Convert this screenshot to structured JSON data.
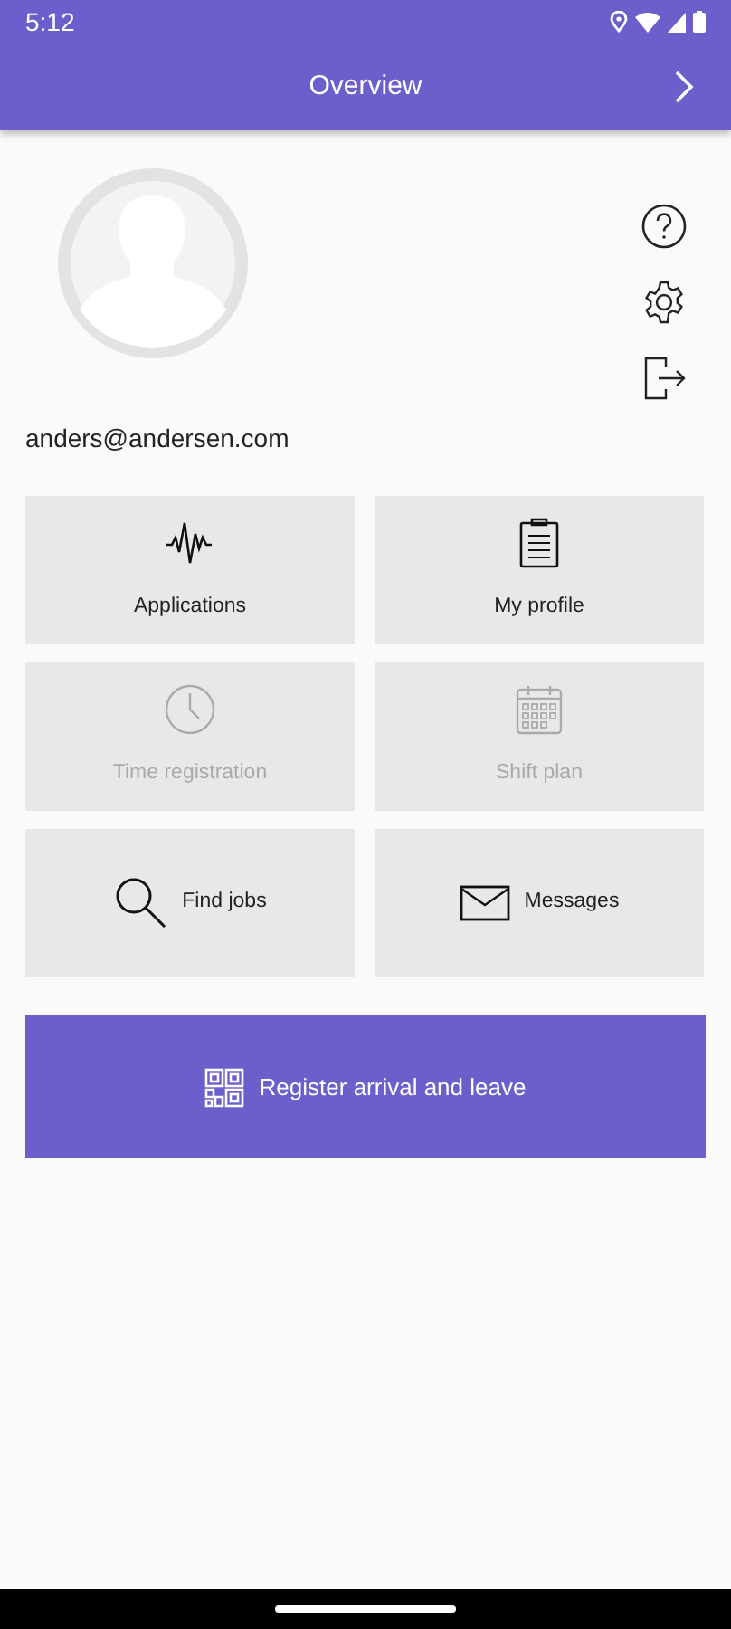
{
  "status_bar": {
    "time": "5:12"
  },
  "app_bar": {
    "title": "Overview"
  },
  "profile": {
    "email": "anders@andersen.com"
  },
  "tiles": [
    {
      "label": "Applications",
      "kind": "stacked",
      "disabled": false
    },
    {
      "label": "My profile",
      "kind": "stacked",
      "disabled": false
    },
    {
      "label": "Time registration",
      "kind": "stacked",
      "disabled": true
    },
    {
      "label": "Shift plan",
      "kind": "stacked",
      "disabled": true
    },
    {
      "label": "Find jobs",
      "kind": "inline",
      "disabled": false
    },
    {
      "label": "Messages",
      "kind": "inline",
      "disabled": false
    }
  ],
  "register_button": {
    "label": "Register arrival and leave"
  }
}
